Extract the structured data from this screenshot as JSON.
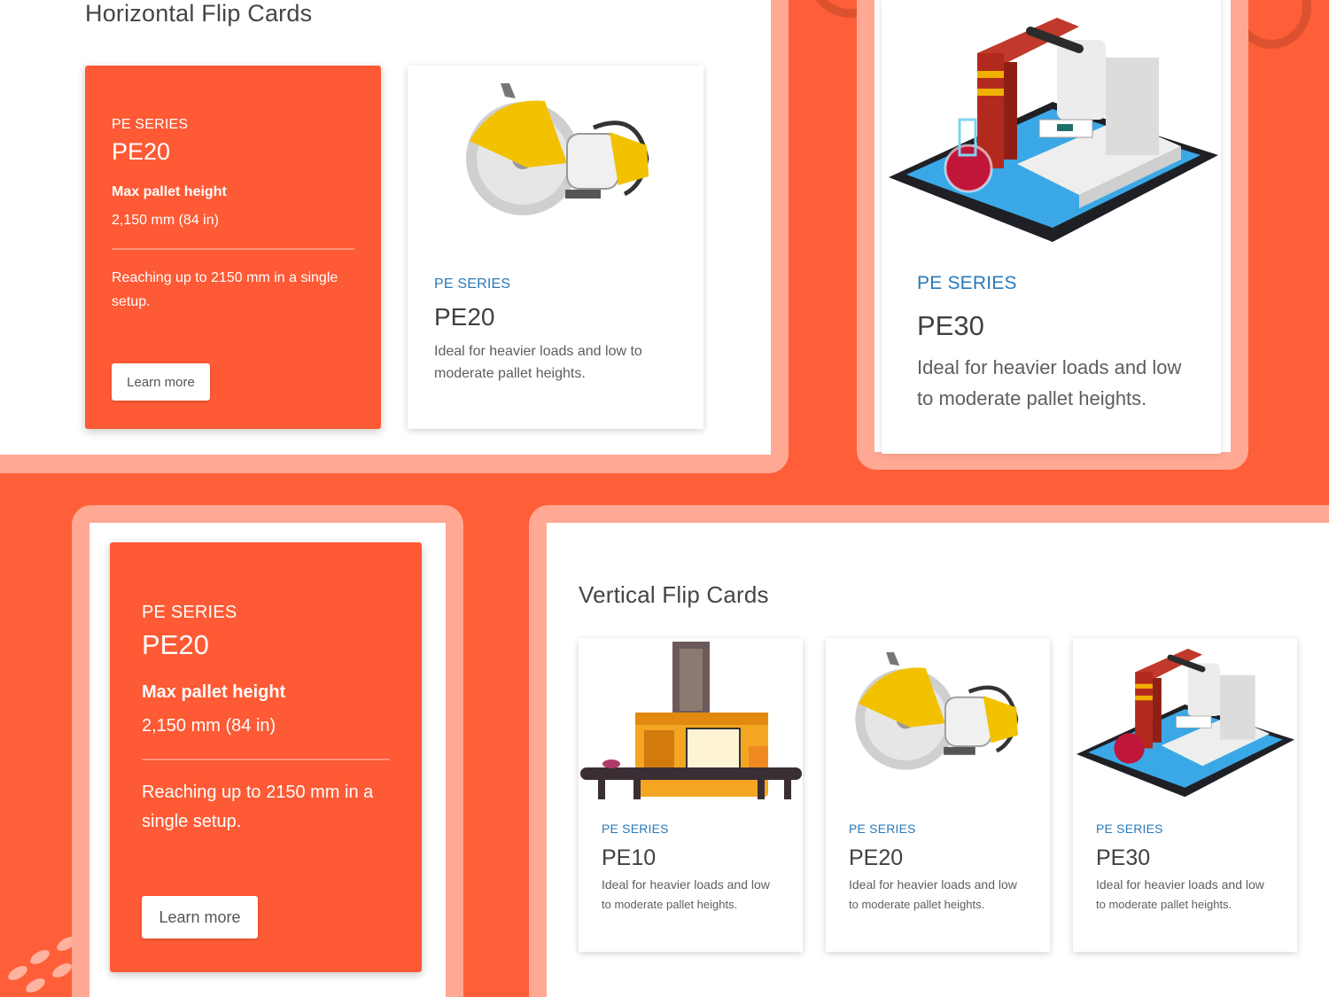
{
  "horizontal_section": {
    "title": "Horizontal Flip Cards",
    "back_card": {
      "series": "PE SERIES",
      "model": "PE20",
      "spec_label": "Max pallet height",
      "spec_value": "2,150 mm (84 in)",
      "text": "Reaching up to 2150 mm in a single setup.",
      "button": "Learn more"
    },
    "front_card": {
      "series": "PE SERIES",
      "model": "PE20",
      "description": "Ideal for heavier loads and low to moderate pallet heights.",
      "illustration": "circular-saw-icon"
    }
  },
  "zoom_card_pe30": {
    "series": "PE SERIES",
    "model": "PE30",
    "description": "Ideal for heavier loads and low to moderate pallet heights.",
    "illustration": "microscope-tablet-icon"
  },
  "zoom_back_card": {
    "series": "PE SERIES",
    "model": "PE20",
    "spec_label": "Max pallet height",
    "spec_value": "2,150 mm (84 in)",
    "text": "Reaching up to 2150 mm in a single setup.",
    "button": "Learn more"
  },
  "vertical_section": {
    "title": "Vertical Flip Cards",
    "cards": [
      {
        "series": "PE SERIES",
        "model": "PE10",
        "description": "Ideal for heavier loads and low",
        "description2": "to moderate pallet heights.",
        "illustration": "factory-machine-icon"
      },
      {
        "series": "PE SERIES",
        "model": "PE20",
        "description": "Ideal for heavier loads and low",
        "description2": "to moderate pallet heights.",
        "illustration": "circular-saw-icon"
      },
      {
        "series": "PE SERIES",
        "model": "PE30",
        "description": "Ideal for heavier loads and low",
        "description2": "to moderate pallet heights.",
        "illustration": "microscope-tablet-icon"
      }
    ]
  },
  "colors": {
    "background": "#fe5f38",
    "frame": "#ffa995",
    "card_back": "#fe5a35",
    "series_text": "#2a79b8"
  }
}
